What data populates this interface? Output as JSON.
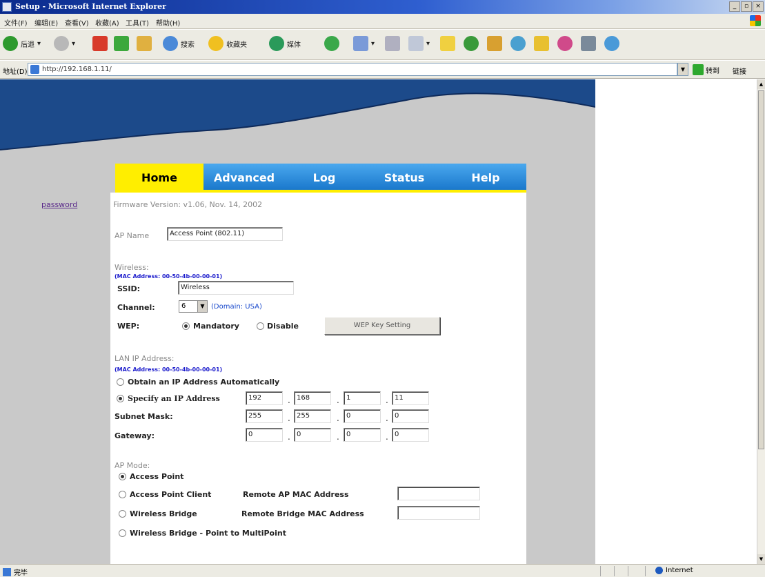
{
  "window": {
    "title": "Setup - Microsoft Internet Explorer",
    "min": "_",
    "max": "▫",
    "close": "×"
  },
  "menu": [
    "文件(F)",
    "编辑(E)",
    "查看(V)",
    "收藏(A)",
    "工具(T)",
    "帮助(H)"
  ],
  "toolbar": {
    "back": "后退",
    "search": "搜索",
    "favorites": "收藏夹",
    "media": "媒体"
  },
  "address": {
    "label": "地址(D)",
    "url": "http://192.168.1.11/",
    "go": "转到",
    "links": "链接"
  },
  "tabs": [
    "Home",
    "Advanced",
    "Log",
    "Status",
    "Help"
  ],
  "sidebar": {
    "password": "password"
  },
  "form": {
    "firmware": "Firmware Version: v1.06, Nov. 14, 2002",
    "ap_name_label": "AP Name",
    "ap_name_value": "Access Point (802.11)",
    "wireless_heading": "Wireless:",
    "wireless_mac": "(MAC Address: 00-50-4b-00-00-01)",
    "ssid_label": "SSID:",
    "ssid_value": "Wireless",
    "channel_label": "Channel:",
    "channel_value": "6",
    "domain": "(Domain: USA)",
    "wep_label": "WEP:",
    "wep_mandatory": "Mandatory",
    "wep_disable": "Disable",
    "wep_button": "WEP Key Setting",
    "lan_heading": "LAN IP Address:",
    "lan_mac": "(MAC Address: 00-50-4b-00-00-01)",
    "obtain_auto": "Obtain an IP Address Automatically",
    "specify": "Specify an IP Address",
    "ip": [
      "192",
      "168",
      "1",
      "11"
    ],
    "subnet_label": "Subnet Mask:",
    "subnet": [
      "255",
      "255",
      "0",
      "0"
    ],
    "gateway_label": "Gateway:",
    "gateway": [
      "0",
      "0",
      "0",
      "0"
    ],
    "ap_mode_heading": "AP Mode:",
    "mode_ap": "Access Point",
    "mode_client": "Access Point Client",
    "remote_ap_mac": "Remote AP MAC Address",
    "mode_bridge": "Wireless Bridge",
    "remote_bridge_mac": "Remote Bridge MAC Address",
    "mode_multipoint": "Wireless Bridge - Point to MultiPoint"
  },
  "status": {
    "left": "完毕",
    "zone": "Internet"
  },
  "colors": {
    "tab_active": "#ffee00",
    "tab_inactive": "#1a78cc",
    "banner_blue": "#1c4a8a",
    "page_gray": "#c9c9c9"
  }
}
